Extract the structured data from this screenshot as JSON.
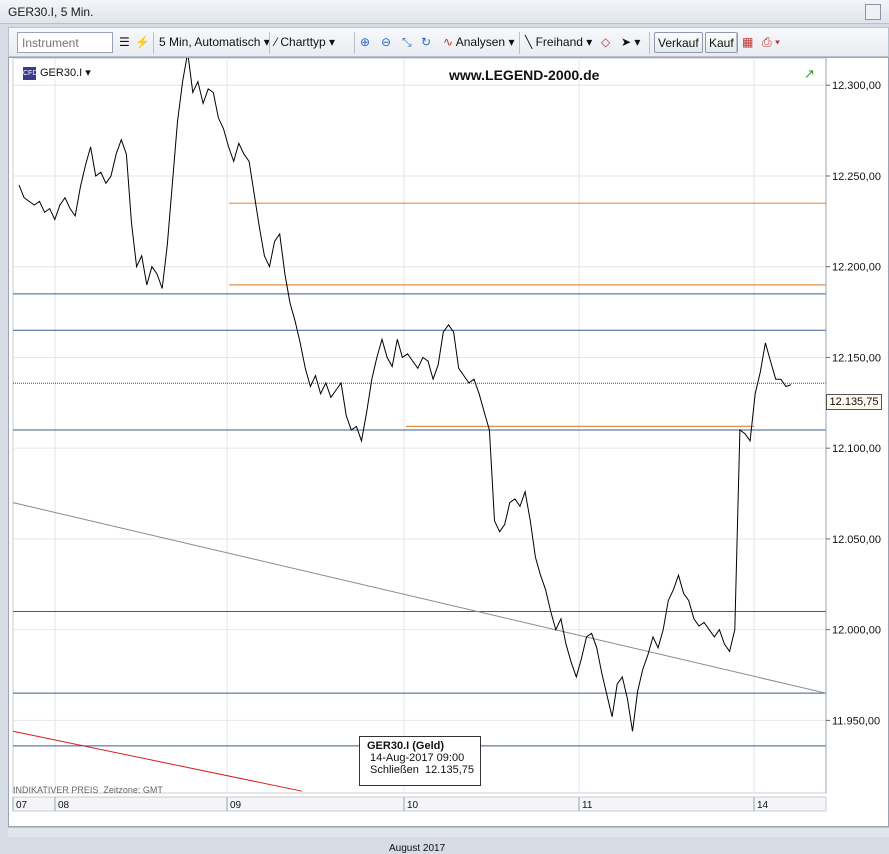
{
  "window": {
    "title": "GER30.I, 5 Min."
  },
  "toolbar": {
    "instrument_placeholder": "Instrument",
    "interval_label": "5 Min,  Automatisch",
    "charttype_label": "Charttyp",
    "analysen_label": "Analysen",
    "freihand_label": "Freihand",
    "verkauf_label": "Verkauf",
    "kauf_label": "Kauf"
  },
  "chart_header": {
    "symbol": "GER30.I",
    "watermark": "www.LEGEND-2000.de"
  },
  "tooltip": {
    "title": "GER30.I (Geld)",
    "date": "14-Aug-2017 09:00",
    "close_label": "Schließen",
    "close_value": "12.135,75"
  },
  "footer": {
    "indikativ": "INDIKATIVER PREIS",
    "zeitzone": "Zeitzone: GMT",
    "month": "August 2017"
  },
  "price_badge": "12.135,75",
  "colors": {
    "price_line": "#000000",
    "horizontal_blue": "#3b5b8c",
    "horizontal_orange": "#e0904a",
    "trend_gray": "#8a8a8a",
    "trend_red": "#d42020",
    "current_price": "#a0206a"
  },
  "chart_data": {
    "type": "line",
    "series": [
      {
        "values": [
          12245,
          12238,
          12236,
          12234,
          12236,
          12230,
          12232,
          12226,
          12234,
          12238,
          12232,
          12228,
          12244,
          12256,
          12266,
          12250,
          12252,
          12246,
          12250,
          12262,
          12270,
          12262,
          12224,
          12200,
          12206,
          12190,
          12200,
          12196,
          12188,
          12212,
          12246,
          12280,
          12302,
          12318,
          12296,
          12302,
          12290,
          12298,
          12296,
          12282,
          12276,
          12266,
          12258,
          12268,
          12262,
          12258,
          12240,
          12222,
          12206,
          12200,
          12214,
          12218,
          12196,
          12180,
          12170,
          12158,
          12144,
          12134,
          12140,
          12130,
          12136,
          12128,
          12132,
          12136,
          12118,
          12110,
          12112,
          12104,
          12120,
          12138,
          12150,
          12160,
          12150,
          12145,
          12160,
          12150,
          12152,
          12148,
          12144,
          12150,
          12148,
          12138,
          12146,
          12164,
          12168,
          12164,
          12144,
          12140,
          12136,
          12138,
          12130,
          12120,
          12110,
          12060,
          12054,
          12058,
          12070,
          12072,
          12068,
          12076,
          12060,
          12040,
          12030,
          12022,
          12010,
          12000,
          12006,
          11992,
          11982,
          11974,
          11984,
          11996,
          11998,
          11990,
          11976,
          11964,
          11952,
          11970,
          11974,
          11962,
          11944,
          11966,
          11978,
          11986,
          11996,
          11990,
          12000,
          12016,
          12022,
          12030,
          12020,
          12016,
          12006,
          12002,
          12004,
          12000,
          11996,
          12000,
          11992,
          11988,
          12000,
          12110,
          12108,
          12104,
          12130,
          12142,
          12158,
          12148,
          12138,
          12138,
          12134,
          12135
        ],
        "x_dates": [
          "2017-08-08",
          "2017-08-14"
        ]
      }
    ],
    "x_ticks": [
      "07",
      "08",
      "09",
      "10",
      "11",
      "14"
    ],
    "xlabel": "August 2017",
    "ylim": [
      11910,
      12315
    ],
    "y_ticks": [
      "11.950,00",
      "12.000,00",
      "12.050,00",
      "12.100,00",
      "12.150,00",
      "12.200,00",
      "12.250,00",
      "12.300,00"
    ],
    "horizontal_lines_blue": [
      12185,
      12165,
      12110,
      12010,
      11965,
      11936
    ],
    "horizontal_lines_orange": [
      {
        "y": 12235,
        "from": "09"
      },
      {
        "y": 12190,
        "from": "09"
      },
      {
        "y": 12112,
        "from": "10",
        "to": "14"
      }
    ],
    "trendlines": [
      {
        "color": "gray",
        "from": [
          "07",
          12070
        ],
        "to": [
          "14",
          11965
        ]
      },
      {
        "color": "red",
        "from": [
          "07",
          11944
        ],
        "to": [
          "09",
          11911
        ]
      }
    ],
    "current_price": 12135.75
  }
}
